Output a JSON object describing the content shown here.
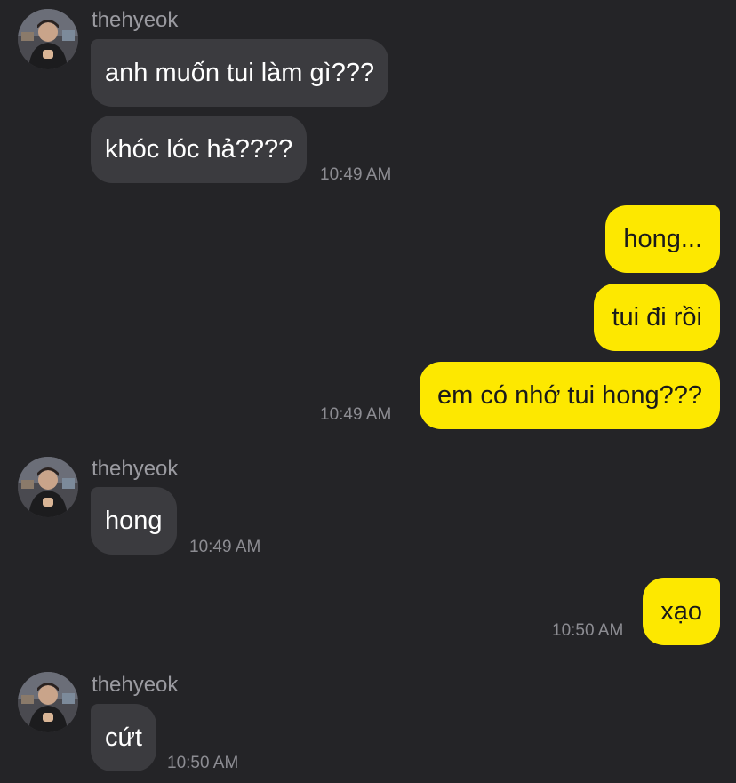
{
  "colors": {
    "background": "#242427",
    "incoming_bubble": "#3b3b3f",
    "outgoing_bubble": "#fde800"
  },
  "groups": [
    {
      "sender": "thehyeok",
      "direction": "incoming",
      "messages": [
        "anh muốn tui làm gì???",
        "khóc lóc hả????"
      ],
      "time": "10:49 AM"
    },
    {
      "direction": "outgoing",
      "messages": [
        "hong...",
        "tui đi rồi",
        "em có nhớ tui hong???"
      ],
      "time": "10:49 AM"
    },
    {
      "sender": "thehyeok",
      "direction": "incoming",
      "messages": [
        "hong"
      ],
      "time": "10:49 AM"
    },
    {
      "direction": "outgoing",
      "messages": [
        "xạo"
      ],
      "time": "10:50 AM"
    },
    {
      "sender": "thehyeok",
      "direction": "incoming",
      "messages": [
        "cứt"
      ],
      "time": "10:50 AM"
    }
  ]
}
